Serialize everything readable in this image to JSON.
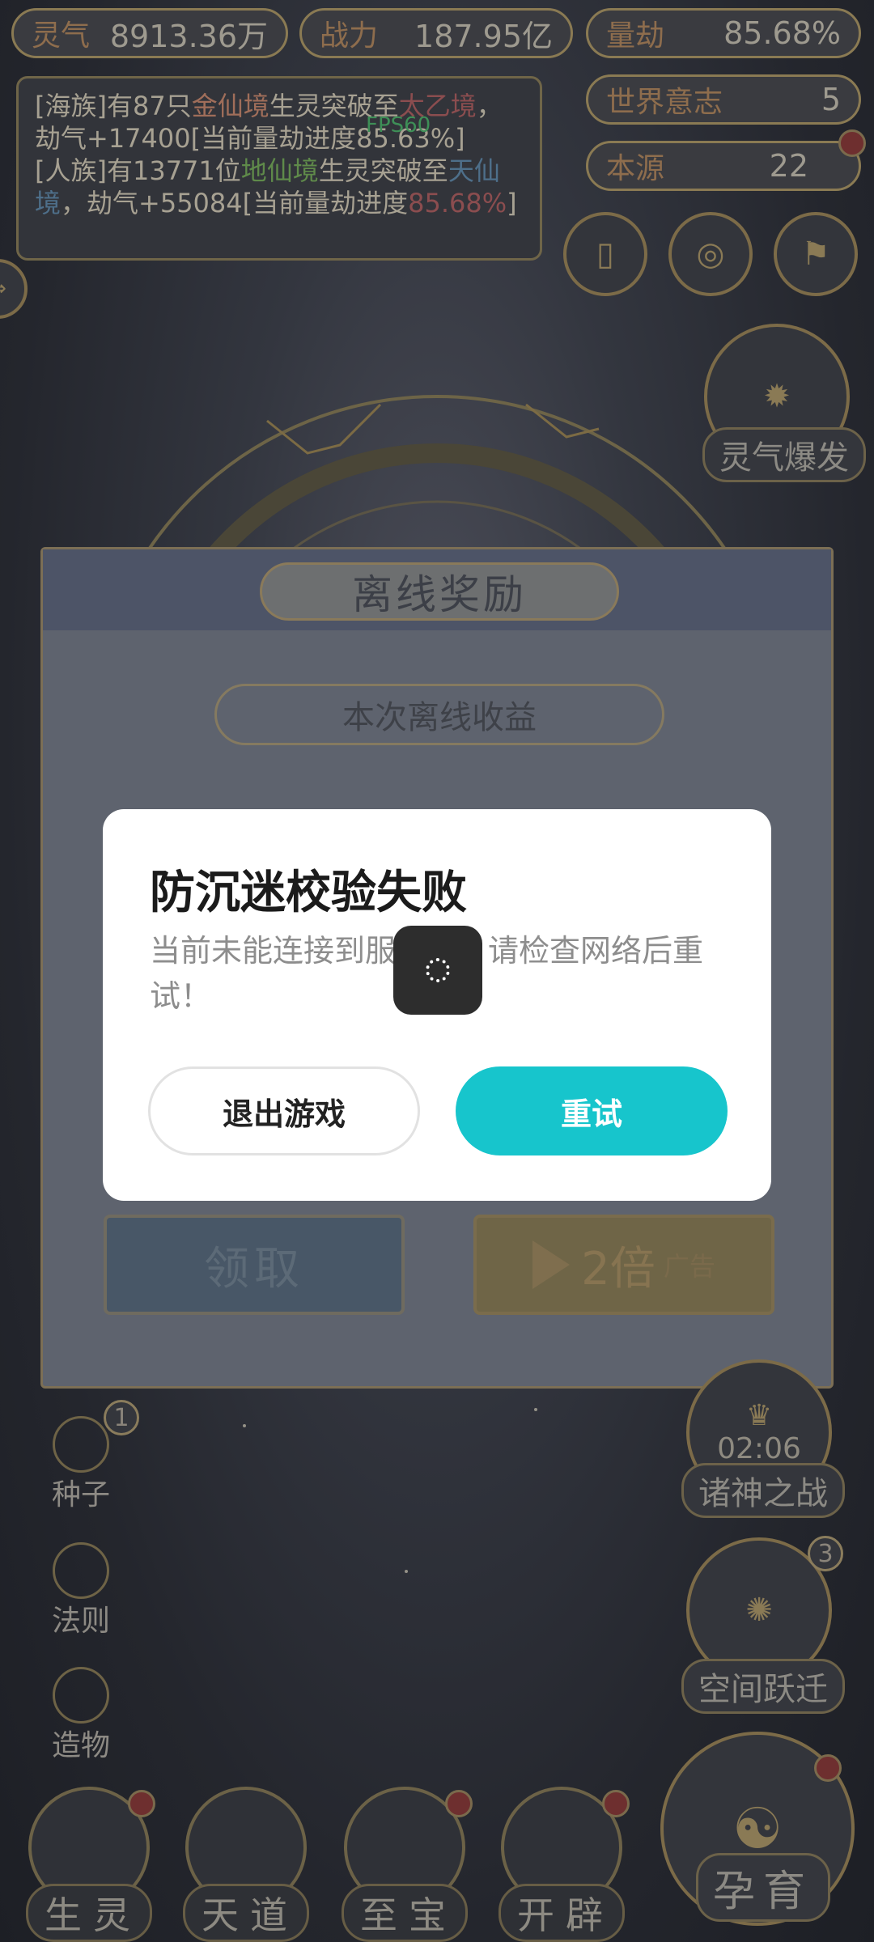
{
  "top_stats": {
    "lingqi": {
      "label": "灵气",
      "value": "8913.36万"
    },
    "zhanli": {
      "label": "战力",
      "value": "187.95亿"
    },
    "liangjie": {
      "label": "量劫",
      "value": "85.68%"
    },
    "shijie_yizhi": {
      "label": "世界意志",
      "value": "5"
    },
    "benyuan": {
      "label": "本源",
      "value": "22"
    }
  },
  "log": {
    "line1_a": "[海族]有87只",
    "line1_gold": "金仙境",
    "line1_b": "生灵突破至",
    "line1_red": "太乙境",
    "line1_c": "，劫气+17400[当前量劫进度85.63%]",
    "line2_a": "[人族]有13771位",
    "line2_green": "地仙境",
    "line2_b": "生灵突破至",
    "line2_blue": "天仙境",
    "line2_c": "，劫气+55084[当前量劫进度",
    "line2_red": "85.68%",
    "line2_end": "]"
  },
  "fps": "FPS60",
  "side": {
    "burst_label": "灵气爆发",
    "war_timer": "02:06",
    "war_label": "诸神之战",
    "space_label": "空间跃迁",
    "space_badge": "3",
    "seed_label": "种子",
    "seed_badge": "1",
    "law_label": "法则",
    "create_label": "造物",
    "yunyu_label": "孕育"
  },
  "bottom_nav": [
    {
      "label": "生灵"
    },
    {
      "label": "天道"
    },
    {
      "label": "至宝"
    },
    {
      "label": "开辟"
    }
  ],
  "reward": {
    "title": "离线奖励",
    "subtitle": "本次离线收益",
    "claim": "领取",
    "double": "2倍",
    "ad": "广告"
  },
  "dialog": {
    "title": "防沉迷校验失败",
    "message": "当前未能连接到服务器，请检查网络后重试！",
    "exit_label": "退出游戏",
    "retry_label": "重试"
  },
  "colors": {
    "retry_button": "#17c5cc",
    "dialog_bg": "#ffffff"
  }
}
